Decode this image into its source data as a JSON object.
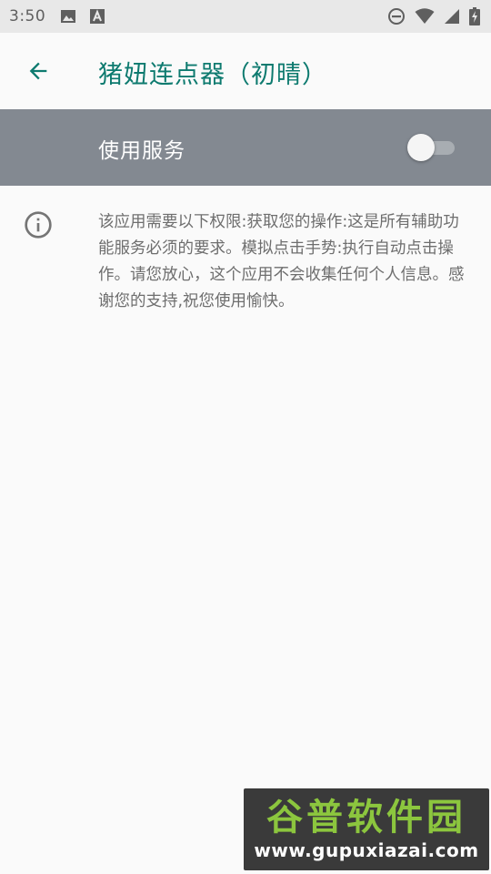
{
  "status_bar": {
    "time": "3:50",
    "icons": [
      "image-icon",
      "text-a-icon",
      "do-not-disturb-icon",
      "wifi-icon",
      "signal-icon",
      "battery-charging-icon"
    ]
  },
  "app_bar": {
    "back_icon": "arrow-back-icon",
    "title": "猪妞连点器（初晴）"
  },
  "service_switch": {
    "label": "使用服务",
    "enabled": false
  },
  "description": {
    "icon": "info-icon",
    "text": "该应用需要以下权限:获取您的操作:这是所有辅助功能服务必须的要求。模拟点击手势:执行自动点击操作。请您放心，这个应用不会收集任何个人信息。感谢您的支持,祝您使用愉快。"
  },
  "watermark": {
    "logo_text": "谷普软件园",
    "url": "www.gupuxiazai.com"
  },
  "colors": {
    "accent": "#0d7a6f",
    "switch_bar": "#838991",
    "background": "#fafafa",
    "status_bar": "#e8e8e8",
    "watermark_green": "#8cc63e"
  }
}
